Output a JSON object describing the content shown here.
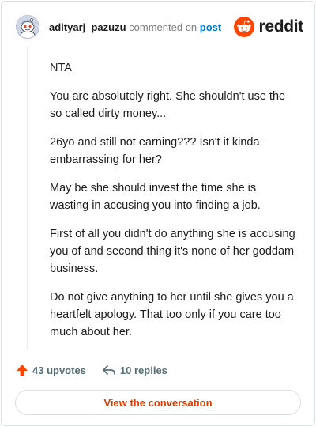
{
  "header": {
    "username": "adityarj_pazuzu",
    "commented_on": "commented on",
    "post_link": "post",
    "logo_text": "reddit",
    "avatar_icon": "snoo-avatar-icon",
    "logo_icon": "reddit-snoo-icon",
    "brand_color": "#ff4500"
  },
  "comment": {
    "paragraphs": [
      "NTA",
      "You are absolutely right. She shouldn't use the so called dirty money...",
      "26yo and still not earning??? Isn't it kinda embarrassing for her?",
      "May be she should invest the time she is wasting in accusing you into finding a job.",
      "First of all you didn't do anything she is accusing you of and second thing it's none of her goddam business.",
      "Do not give anything to her until she gives you a heartfelt apology. That too only if you care too much about her."
    ]
  },
  "actions": {
    "upvotes": "43 upvotes",
    "replies": "10 replies",
    "upvote_icon": "upvote-arrow-icon",
    "reply_icon": "reply-arrow-icon",
    "upvote_color": "#ff4500"
  },
  "cta": {
    "label": "View the conversation",
    "color": "#d93a00"
  }
}
